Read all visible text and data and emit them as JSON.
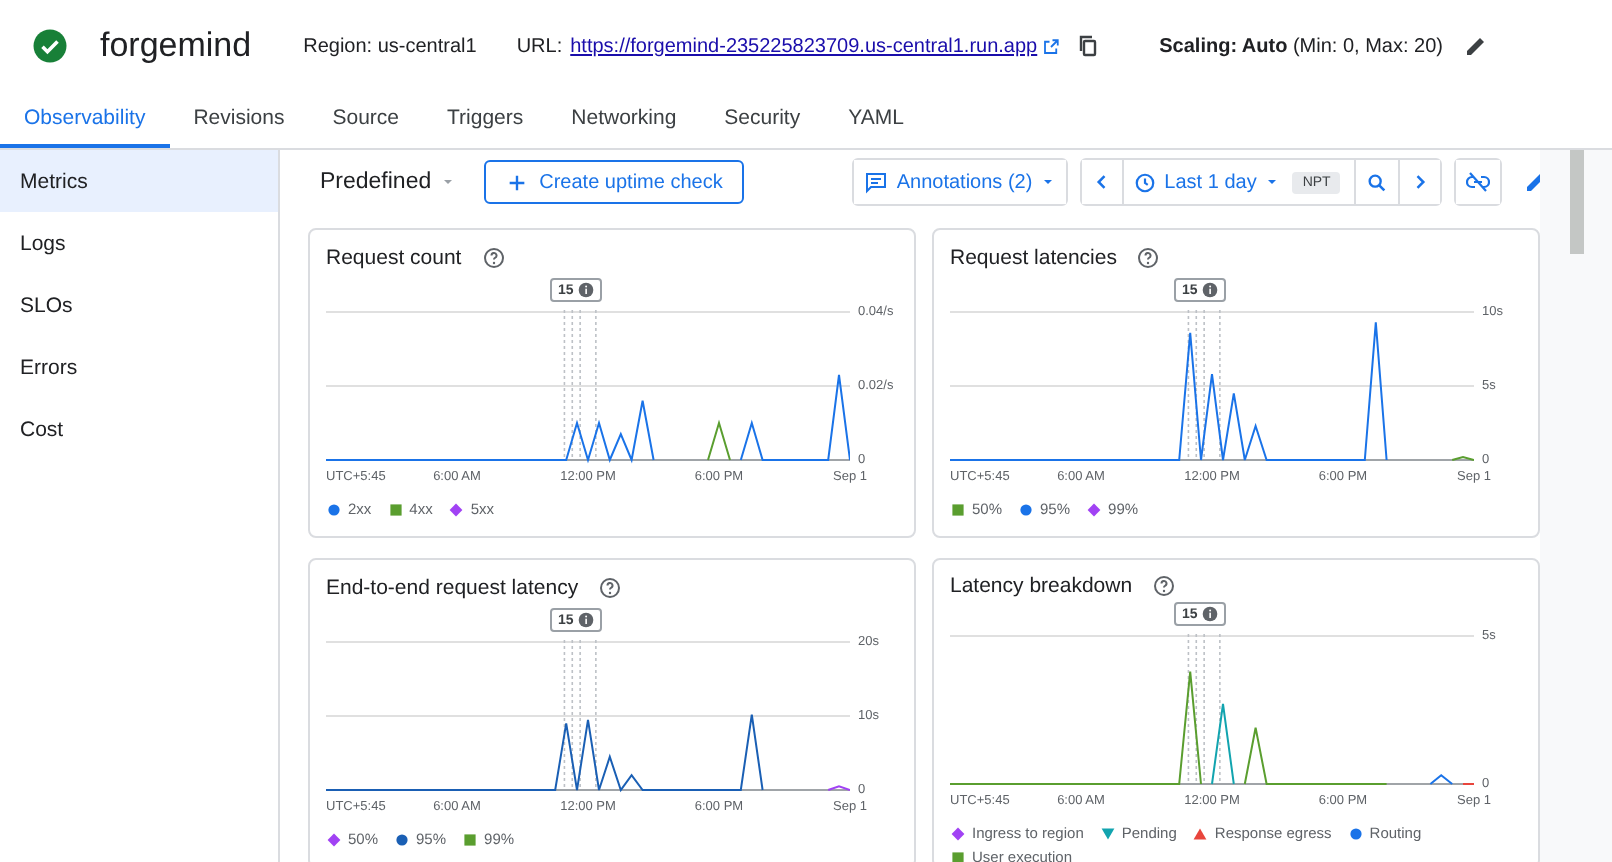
{
  "header": {
    "service": "forgemind",
    "region": "Region: us-central1",
    "url_label": "URL:",
    "url": "https://forgemind-235225823709.us-central1.run.app",
    "scaling": "**Scaling: Auto** (Min: 0, Max: 20)"
  },
  "tabs": [
    {
      "label": "Observability",
      "selected": true
    },
    {
      "label": "Revisions",
      "selected": false
    },
    {
      "label": "Source",
      "selected": false
    },
    {
      "label": "Triggers",
      "selected": false
    },
    {
      "label": "Networking",
      "selected": false
    },
    {
      "label": "Security",
      "selected": false
    },
    {
      "label": "YAML",
      "selected": false
    }
  ],
  "sidebar": {
    "items": [
      {
        "label": "Metrics",
        "selected": true
      },
      {
        "label": "Logs",
        "selected": false
      },
      {
        "label": "SLOs",
        "selected": false
      },
      {
        "label": "Errors",
        "selected": false
      },
      {
        "label": "Cost",
        "selected": false
      }
    ]
  },
  "toolbar": {
    "preset": "Predefined",
    "create_button": "Create uptime check",
    "annotations": "Annotations (2)",
    "time_range": "Last 1 day",
    "timezone": "NPT"
  },
  "charts": [
    {
      "title": "Request count",
      "annotation": "15",
      "timezone_label": "UTC+5:45",
      "legend": [
        {
          "kind": "circle"
        },
        {
          "kind": "square"
        },
        {
          "kind": "diamond"
        }
      ],
      "chart_data": {
        "type": "line",
        "x": [
          0,
          11,
          11.5,
          12,
          12.5,
          13,
          13.5,
          14,
          14.5,
          15,
          17.5,
          18,
          18.5,
          19,
          19.5,
          20,
          23,
          23.5,
          24
        ],
        "xlim": [
          0,
          24
        ],
        "ylim": [
          0,
          0.04
        ],
        "xticks": [
          {
            "value": 6,
            "label": "6:00 AM"
          },
          {
            "value": 12,
            "label": "12:00 PM"
          },
          {
            "value": 18,
            "label": "6:00 PM"
          },
          {
            "value": 24,
            "label": "Sep 1"
          }
        ],
        "yticks": [
          {
            "value": 0.04,
            "label": "0.04/s"
          },
          {
            "value": 0.02,
            "label": "0.02/s"
          },
          {
            "value": 0,
            "label": "0"
          }
        ],
        "series": [
          {
            "name": "2xx",
            "color": "#1a73e8",
            "values": [
              0,
              0,
              0.01,
              0,
              0.01,
              0,
              0.007,
              0,
              0.016,
              0,
              null,
              null,
              null,
              0,
              0.01,
              0,
              0,
              0.023,
              0
            ]
          },
          {
            "name": "4xx",
            "color": "#5a9e2f",
            "values": [
              null,
              null,
              null,
              null,
              null,
              null,
              null,
              null,
              null,
              null,
              0,
              0.01,
              0,
              null,
              null,
              null,
              null,
              null,
              null
            ]
          },
          {
            "name": "5xx",
            "color": "#a142f4",
            "values": [
              null,
              null,
              null,
              null,
              null,
              null,
              null,
              null,
              null,
              null,
              null,
              null,
              null,
              null,
              null,
              null,
              null,
              null,
              null
            ]
          }
        ]
      }
    },
    {
      "title": "Request latencies",
      "annotation": "15",
      "timezone_label": "UTC+5:45",
      "legend": [
        {
          "kind": "square"
        },
        {
          "kind": "circle"
        },
        {
          "kind": "diamond"
        }
      ],
      "chart_data": {
        "type": "line",
        "x": [
          0,
          10.5,
          11,
          11.5,
          12,
          12.5,
          13,
          13.5,
          14,
          14.5,
          19,
          19.5,
          20,
          23,
          23.5,
          24
        ],
        "xlim": [
          0,
          24
        ],
        "ylim": [
          0,
          10
        ],
        "xticks": [
          {
            "value": 6,
            "label": "6:00 AM"
          },
          {
            "value": 12,
            "label": "12:00 PM"
          },
          {
            "value": 18,
            "label": "6:00 PM"
          },
          {
            "value": 24,
            "label": "Sep 1"
          }
        ],
        "yticks": [
          {
            "value": 10,
            "label": "10s"
          },
          {
            "value": 5,
            "label": "5s"
          },
          {
            "value": 0,
            "label": "0"
          }
        ],
        "series": [
          {
            "name": "50%",
            "color": "#5a9e2f",
            "values": [
              null,
              null,
              null,
              null,
              null,
              null,
              null,
              null,
              null,
              null,
              null,
              null,
              null,
              0,
              0.2,
              0
            ]
          },
          {
            "name": "95%",
            "color": "#1a73e8",
            "values": [
              0,
              0,
              8.6,
              0,
              5.8,
              0,
              4.5,
              0,
              2.3,
              0,
              0,
              9.3,
              0,
              null,
              null,
              null
            ]
          },
          {
            "name": "99%",
            "color": "#a142f4",
            "values": [
              null,
              null,
              null,
              null,
              null,
              null,
              null,
              null,
              null,
              null,
              null,
              null,
              null,
              null,
              null,
              null
            ]
          }
        ]
      }
    },
    {
      "title": "End-to-end request latency",
      "annotation": "15",
      "timezone_label": "UTC+5:45",
      "legend": [
        {
          "kind": "diamond"
        },
        {
          "kind": "circle"
        },
        {
          "kind": "square"
        }
      ],
      "chart_data": {
        "type": "line",
        "x": [
          0,
          10.5,
          11,
          11.5,
          12,
          12.5,
          13,
          13.5,
          14,
          14.5,
          19,
          19.5,
          20,
          23,
          23.5,
          24
        ],
        "xlim": [
          0,
          24
        ],
        "ylim": [
          0,
          20
        ],
        "xticks": [
          {
            "value": 6,
            "label": "6:00 AM"
          },
          {
            "value": 12,
            "label": "12:00 PM"
          },
          {
            "value": 18,
            "label": "6:00 PM"
          },
          {
            "value": 24,
            "label": "Sep 1"
          }
        ],
        "yticks": [
          {
            "value": 20,
            "label": "20s"
          },
          {
            "value": 10,
            "label": "10s"
          },
          {
            "value": 0,
            "label": "0"
          }
        ],
        "series": [
          {
            "name": "50%",
            "color": "#a142f4",
            "values": [
              null,
              null,
              null,
              null,
              null,
              null,
              null,
              null,
              null,
              null,
              null,
              null,
              null,
              0,
              0.5,
              0
            ]
          },
          {
            "name": "95%",
            "color": "#1a5fb4",
            "values": [
              0,
              0,
              9,
              0,
              9.5,
              0,
              4.5,
              0,
              2,
              0,
              0,
              10.2,
              0,
              null,
              null,
              null
            ]
          },
          {
            "name": "99%",
            "color": "#5a9e2f",
            "values": [
              null,
              null,
              null,
              null,
              null,
              null,
              null,
              null,
              null,
              null,
              null,
              null,
              null,
              null,
              null,
              null
            ]
          }
        ]
      }
    },
    {
      "title": "Latency breakdown",
      "annotation": "15",
      "timezone_label": "UTC+5:45",
      "legend": [
        {
          "kind": "diamond"
        },
        {
          "kind": "triangle-down"
        },
        {
          "kind": "triangle"
        },
        {
          "kind": "circle"
        },
        {
          "kind": "square"
        }
      ],
      "chart_data": {
        "type": "line",
        "x": [
          0,
          10.5,
          11,
          11.5,
          12,
          12.5,
          13,
          13.5,
          14,
          14.5,
          20,
          22,
          22.5,
          23,
          23.5,
          24
        ],
        "xlim": [
          0,
          24
        ],
        "ylim": [
          0,
          5
        ],
        "xticks": [
          {
            "value": 6,
            "label": "6:00 AM"
          },
          {
            "value": 12,
            "label": "12:00 PM"
          },
          {
            "value": 18,
            "label": "6:00 PM"
          },
          {
            "value": 24,
            "label": "Sep 1"
          }
        ],
        "yticks": [
          {
            "value": 5,
            "label": "5s"
          },
          {
            "value": 0,
            "label": "0"
          }
        ],
        "series": [
          {
            "name": "Ingress to region",
            "color": "#a142f4",
            "values": [
              null,
              null,
              null,
              null,
              null,
              null,
              null,
              null,
              null,
              null,
              null,
              null,
              null,
              null,
              null,
              null
            ]
          },
          {
            "name": "Pending",
            "color": "#12a4af",
            "values": [
              null,
              null,
              null,
              null,
              0,
              2.7,
              0,
              null,
              null,
              null,
              null,
              null,
              null,
              null,
              null,
              null
            ]
          },
          {
            "name": "Response egress",
            "color": "#e8453c",
            "values": [
              null,
              null,
              null,
              null,
              null,
              null,
              null,
              null,
              null,
              null,
              null,
              null,
              null,
              null,
              0,
              0
            ]
          },
          {
            "name": "Routing",
            "color": "#1a73e8",
            "values": [
              null,
              null,
              null,
              null,
              null,
              null,
              null,
              null,
              null,
              null,
              null,
              0,
              0.3,
              0,
              null,
              null
            ]
          },
          {
            "name": "User execution",
            "color": "#5a9e2f",
            "values": [
              0,
              0,
              3.8,
              0,
              null,
              null,
              null,
              0,
              1.9,
              0,
              0,
              null,
              null,
              null,
              null,
              null
            ]
          }
        ]
      }
    }
  ]
}
